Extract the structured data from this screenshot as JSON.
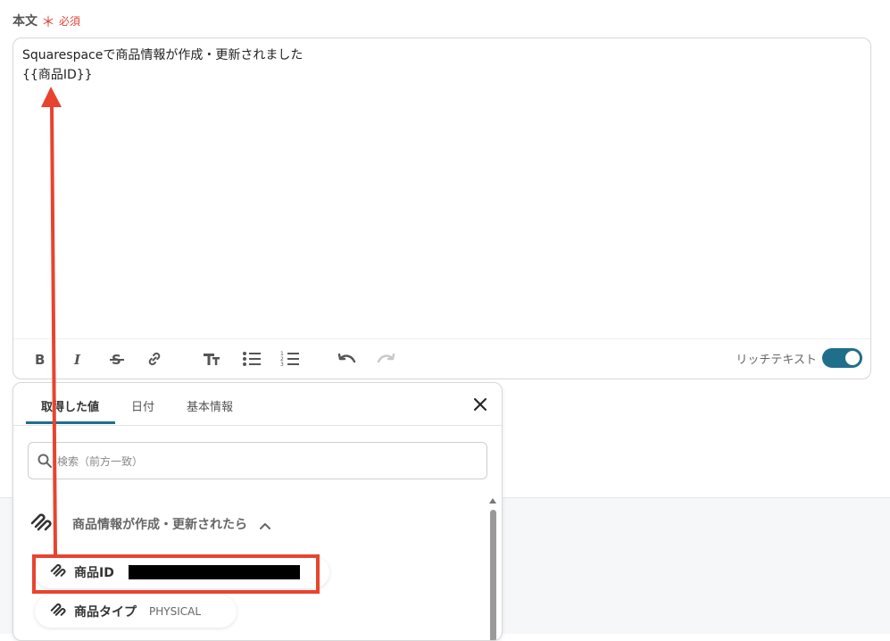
{
  "field": {
    "label": "本文",
    "required_mark": "＊",
    "required_text": "必須"
  },
  "editor": {
    "lines": [
      "Squarespaceで商品情報が作成・更新されました",
      "{{商品ID}}"
    ],
    "rich_text_label": "リッチテキスト",
    "rich_text_enabled": true
  },
  "toolbar": {
    "buttons": [
      "bold-icon",
      "italic-icon",
      "strikethrough-icon",
      "link-icon",
      "text-size-icon",
      "bullet-list-icon",
      "numbered-list-icon",
      "undo-icon",
      "redo-icon"
    ]
  },
  "panel": {
    "tabs": [
      {
        "label": "取得した値",
        "active": true
      },
      {
        "label": "日付",
        "active": false
      },
      {
        "label": "基本情報",
        "active": false
      }
    ],
    "search": {
      "placeholder": "検索（前方一致）",
      "value": ""
    },
    "group": {
      "title": "商品情報が作成・更新されたら",
      "expanded": true
    },
    "items": [
      {
        "name": "商品ID",
        "value": "",
        "redacted": true,
        "highlighted": true
      },
      {
        "name": "商品タイプ",
        "value": "PHYSICAL",
        "redacted": false,
        "highlighted": false
      }
    ]
  },
  "colors": {
    "accent": "#1f6f8b",
    "required": "#e0453a",
    "annotation": "#e8432f"
  }
}
